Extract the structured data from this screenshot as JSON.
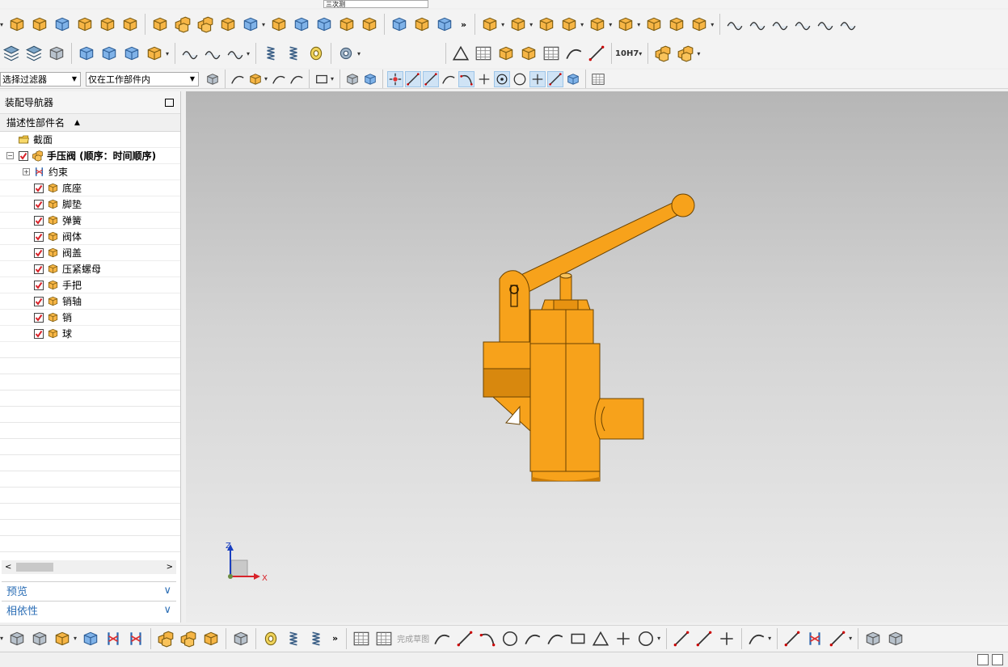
{
  "toolbar": {
    "row0_combo_value": "三次测",
    "more_glyph": "»",
    "selection_filter": "选择过滤器",
    "scope_filter": "仅在工作部件内",
    "fit_label": "10H7",
    "finish_sketch": "完成草图"
  },
  "navigator": {
    "title": "装配导航器",
    "column_header": "描述性部件名",
    "sort_glyph": "▲",
    "rows": [
      {
        "label": "截面"
      },
      {
        "label": "手压阀 (顺序：时间顺序)"
      },
      {
        "label": "约束"
      },
      {
        "label": "底座"
      },
      {
        "label": "脚垫"
      },
      {
        "label": "弹簧"
      },
      {
        "label": "阀体"
      },
      {
        "label": "阀盖"
      },
      {
        "label": "压紧螺母"
      },
      {
        "label": "手把"
      },
      {
        "label": "销轴"
      },
      {
        "label": "销"
      },
      {
        "label": "球"
      }
    ],
    "scroll_left": "<",
    "scroll_right": ">",
    "preview_panel": "预览",
    "dependency_panel": "相依性",
    "panel_chevron": "∨"
  },
  "viewport": {
    "axis_z": "Z",
    "axis_x": "X"
  },
  "colors": {
    "part_orange": "#f7a21b",
    "part_shadow": "#c97a05",
    "accent_blue": "#2a6db5",
    "check_red": "#d8232a"
  }
}
